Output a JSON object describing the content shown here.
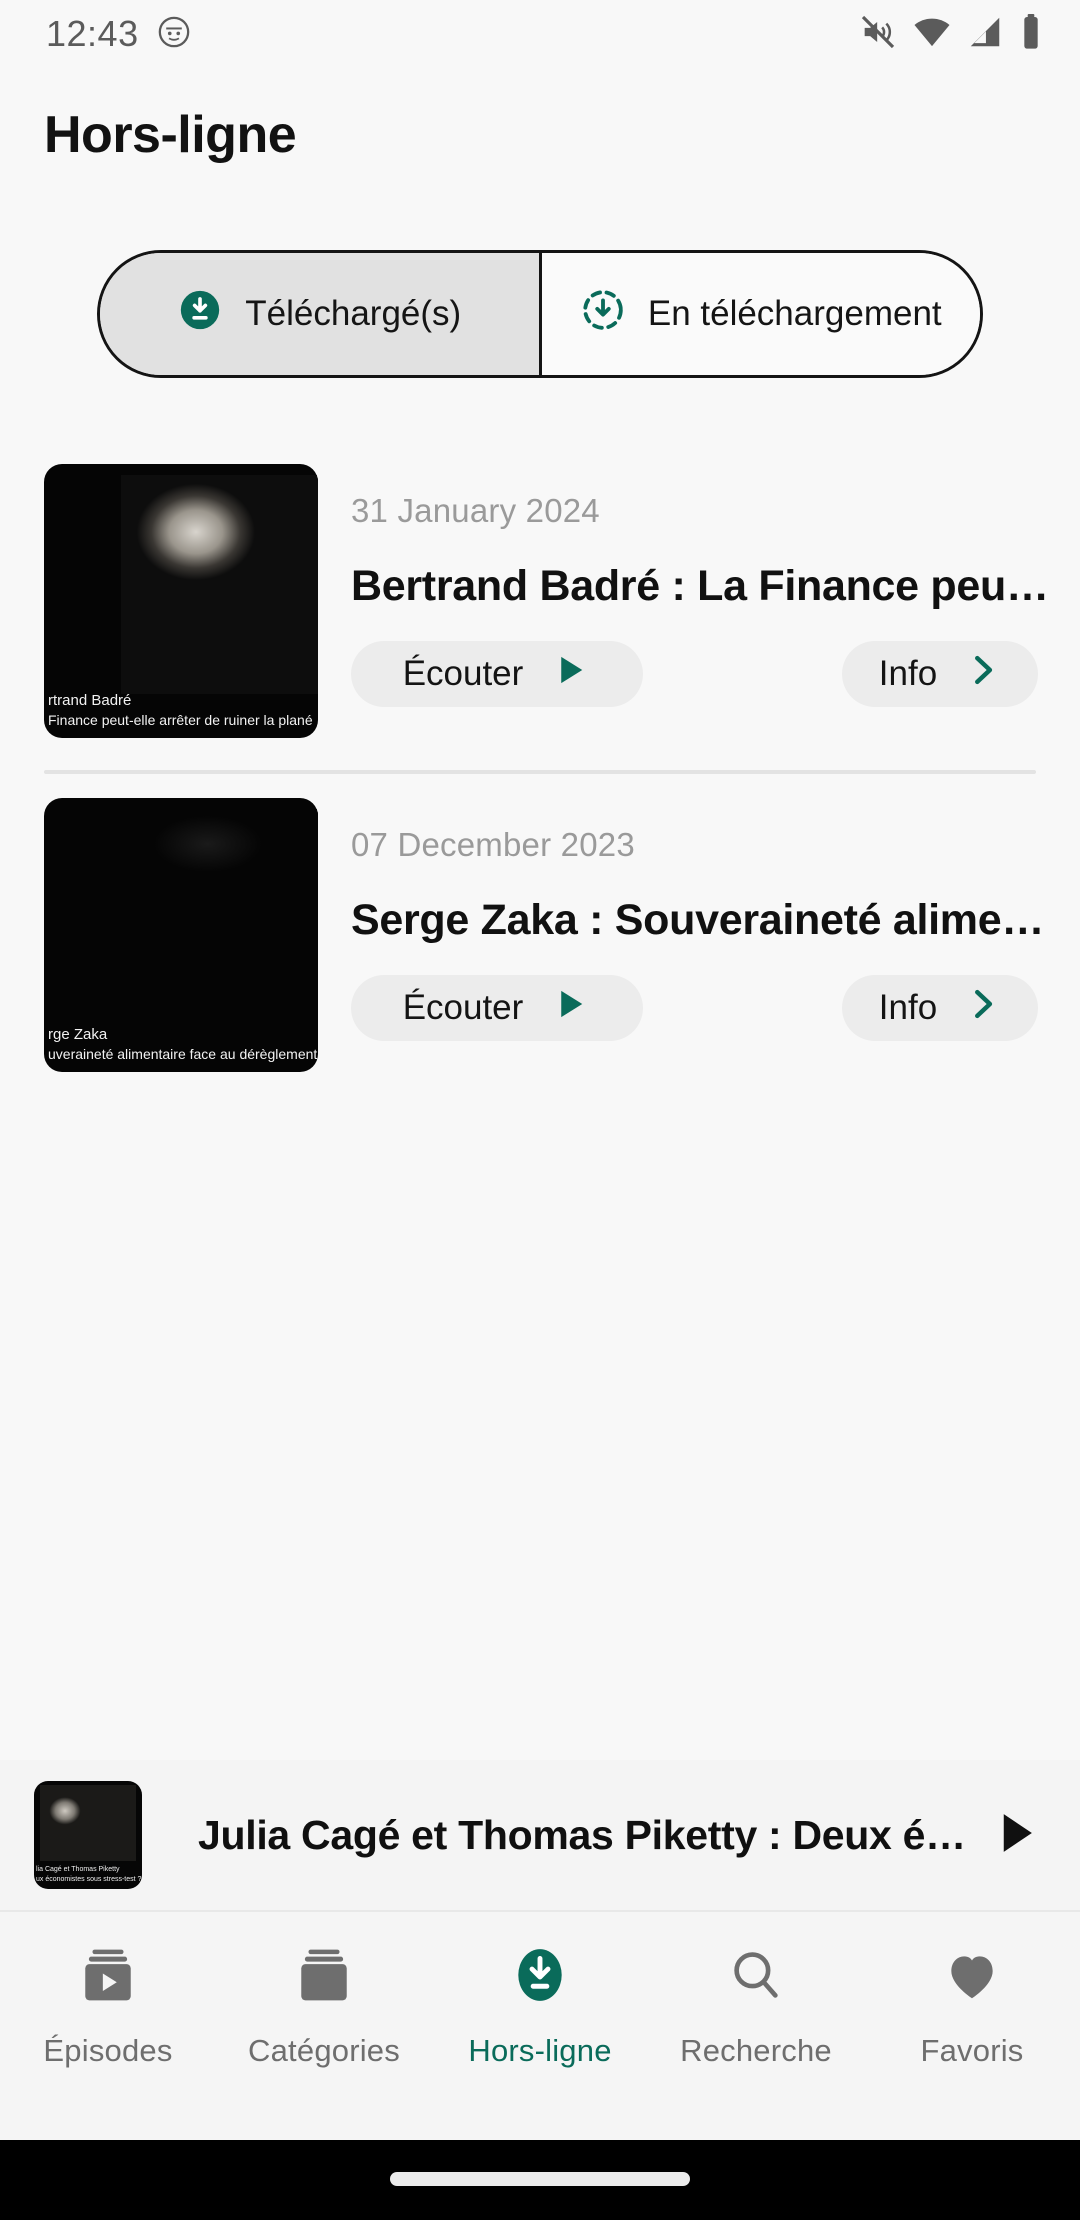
{
  "status_bar": {
    "time": "12:43",
    "icons": [
      "face-badge-icon",
      "volume-mute-icon",
      "wifi-icon",
      "cellular-signal-icon",
      "battery-icon"
    ]
  },
  "header": {
    "title": "Hors-ligne"
  },
  "tabs": {
    "items": [
      {
        "label": "Téléchargé(s)",
        "icon": "download-filled-circle-icon",
        "active": true
      },
      {
        "label": "En téléchargement",
        "icon": "download-dashed-circle-icon",
        "active": false
      }
    ]
  },
  "episodes": [
    {
      "date": "31 January 2024",
      "title": "Bertrand Badré : La Finance peu…",
      "thumbnail_caption_line1": "rtrand Badré",
      "thumbnail_caption_line2": "Finance peut-elle arrêter de ruiner la plané",
      "listen_label": "Écouter",
      "info_label": "Info"
    },
    {
      "date": "07 December 2023",
      "title": "Serge Zaka : Souveraineté alime…",
      "thumbnail_caption_line1": "rge Zaka",
      "thumbnail_caption_line2": "uveraineté alimentaire face au dérèglement",
      "listen_label": "Écouter",
      "info_label": "Info"
    }
  ],
  "mini_player": {
    "title": "Julia Cagé et Thomas Piketty : Deux é…",
    "thumbnail_caption_line1": "lia Cagé et Thomas Piketty",
    "thumbnail_caption_line2": "ux économistes sous stress-test ?",
    "play_icon": "play-icon"
  },
  "bottom_nav": {
    "items": [
      {
        "label": "Épisodes",
        "icon": "video-library-icon",
        "active": false
      },
      {
        "label": "Catégories",
        "icon": "library-books-icon",
        "active": false
      },
      {
        "label": "Hors-ligne",
        "icon": "download-filled-circle-icon",
        "active": true
      },
      {
        "label": "Recherche",
        "icon": "search-icon",
        "active": false
      },
      {
        "label": "Favoris",
        "icon": "heart-icon",
        "active": false
      }
    ]
  },
  "colors": {
    "accent": "#0a6b5a",
    "background": "#f8f8f8",
    "pill_background": "#ececec",
    "muted_text": "#9a9a9a",
    "nav_inactive": "#6e6e6e"
  }
}
